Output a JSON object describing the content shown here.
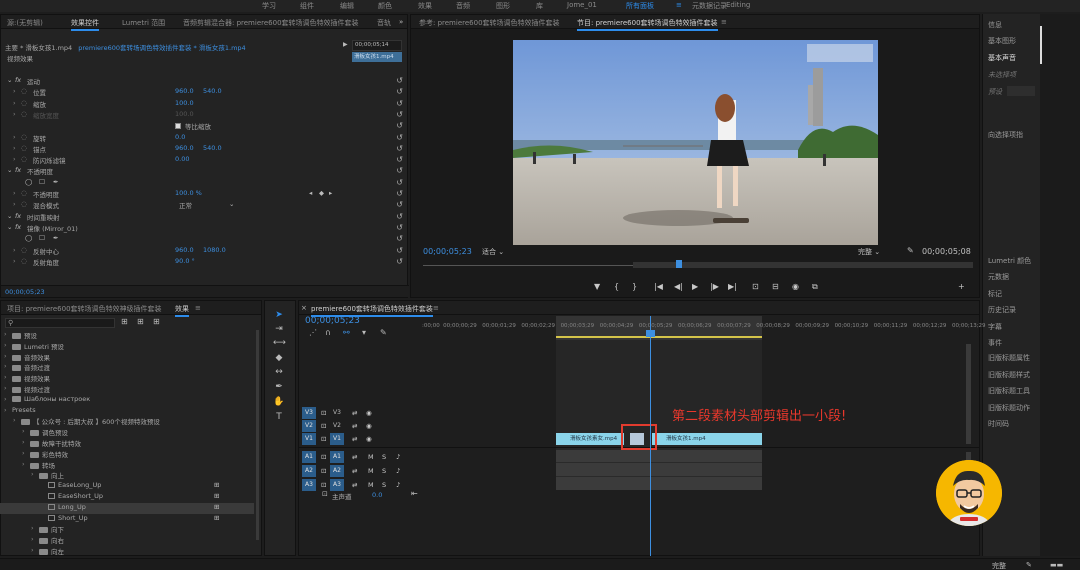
{
  "workspace": {
    "items": [
      "学习",
      "组件",
      "编辑",
      "颜色",
      "效果",
      "音频",
      "图形",
      "库",
      "Jome_01",
      "所有面板",
      "元数据记录",
      "Editing"
    ],
    "active_index": 9,
    "menu_icon": "hamburger-icon"
  },
  "effects_panel": {
    "tabs": [
      "源:(无剪辑)",
      "效果控件",
      "Lumetri 范围",
      "音频剪辑混合器: premiere600套转场调色特效插件套装",
      "音轨"
    ],
    "breadcrumb_master": "主要 * 滑板女孩1.mp4",
    "breadcrumb_seq": "premiere600套转场调色特效插件套装 * 滑板女孩1.mp4",
    "mini_timecode": "00;00;05;14",
    "mini_clip": "滑板女孩1.mp4",
    "section": "视频效果",
    "rows": [
      {
        "indent": 1,
        "fx": true,
        "label": "运动",
        "v1": "",
        "v2": ""
      },
      {
        "indent": 2,
        "label": "位置",
        "v1": "960.0",
        "v2": "540.0"
      },
      {
        "indent": 2,
        "label": "缩放",
        "v1": "100.0",
        "v2": ""
      },
      {
        "indent": 2,
        "label": "缩放宽度",
        "v1": "100.0",
        "v2": "",
        "muted": true
      },
      {
        "indent": 2,
        "label": "",
        "v1": "",
        "v2": "",
        "checkbox": "等比缩放"
      },
      {
        "indent": 2,
        "label": "旋转",
        "v1": "0.0",
        "v2": ""
      },
      {
        "indent": 2,
        "label": "锚点",
        "v1": "960.0",
        "v2": "540.0"
      },
      {
        "indent": 2,
        "label": "防闪烁滤镜",
        "v1": "0.00",
        "v2": ""
      },
      {
        "indent": 1,
        "fx": true,
        "label": "不透明度",
        "v1": "",
        "v2": ""
      },
      {
        "indent": 2,
        "label": "",
        "v1": "",
        "v2": "",
        "shapes": true
      },
      {
        "indent": 2,
        "label": "不透明度",
        "v1": "100.0 %",
        "v2": "",
        "keyframes": true
      },
      {
        "indent": 2,
        "label": "混合模式",
        "v1": "正常",
        "v2": "",
        "select": true
      },
      {
        "indent": 1,
        "fx": true,
        "label": "时间重映射",
        "v1": "",
        "v2": ""
      },
      {
        "indent": 1,
        "fx": true,
        "label": "镜像 (Mirror_01)",
        "v1": "",
        "v2": ""
      },
      {
        "indent": 2,
        "label": "",
        "v1": "",
        "v2": "",
        "shapes": true
      },
      {
        "indent": 2,
        "label": "反射中心",
        "v1": "960.0",
        "v2": "1080.0"
      },
      {
        "indent": 2,
        "label": "反射角度",
        "v1": "90.0 °",
        "v2": ""
      }
    ],
    "bottom_timecode": "00;00;05;23"
  },
  "reference_monitor": {
    "tab": "参考: premiere600套转场调色特效插件套装"
  },
  "program_monitor": {
    "tab": "节目: premiere600套转场调色特效插件套装",
    "timecode": "00;00;05;23",
    "fit": "适合",
    "quality": "完整",
    "duration": "00;00;05;08",
    "playhead_fraction": 0.46
  },
  "project_panel": {
    "tabs": [
      "项目: premiere600套转场调色特效神级插件套装",
      "效果"
    ],
    "search_placeholder": "",
    "tree": [
      {
        "indent": 0,
        "label": "预设"
      },
      {
        "indent": 0,
        "label": "Lumetri 预设"
      },
      {
        "indent": 0,
        "label": "音频效果"
      },
      {
        "indent": 0,
        "label": "音频过渡"
      },
      {
        "indent": 0,
        "label": "视频效果"
      },
      {
        "indent": 0,
        "label": "视频过渡"
      },
      {
        "indent": 0,
        "label": "Шаблоны настроек"
      },
      {
        "indent": 0,
        "label": "Presets",
        "nofolder": true
      },
      {
        "indent": 1,
        "label": "【 公众号 : 后期大叔 】600个视频特效预设"
      },
      {
        "indent": 2,
        "label": "调色预设"
      },
      {
        "indent": 2,
        "label": "故障干扰特效"
      },
      {
        "indent": 2,
        "label": "彩色特效"
      },
      {
        "indent": 2,
        "label": "转场"
      },
      {
        "indent": 3,
        "label": "向上"
      },
      {
        "indent": 4,
        "label": "EaseLong_Up",
        "preset": true
      },
      {
        "indent": 4,
        "label": "EaseShort_Up",
        "preset": true
      },
      {
        "indent": 4,
        "label": "Long_Up",
        "preset": true,
        "selected": true
      },
      {
        "indent": 4,
        "label": "Short_Up",
        "preset": true
      },
      {
        "indent": 3,
        "label": "向下"
      },
      {
        "indent": 3,
        "label": "向右"
      },
      {
        "indent": 3,
        "label": "向左"
      }
    ]
  },
  "timeline": {
    "tab": "premiere600套转场调色特效插件套装",
    "timecode": "00;00;05;23",
    "ruler": [
      ":00;00",
      "00;00;00;29",
      "00;00;01;29",
      "00;00;02;29",
      "00;00;03;29",
      "00;00;04;29",
      "00;00;05;29",
      "00;00;06;29",
      "00;00;07;29",
      "00;00;08;29",
      "00;00;09;29",
      "00;00;10;29",
      "00;00;11;29",
      "00;00;12;29",
      "00;00;13;29"
    ],
    "video_tracks": [
      "V3",
      "V2",
      "V1"
    ],
    "audio_tracks": [
      "A1",
      "A2",
      "A3"
    ],
    "master_label": "主声道",
    "master_value": "0.0",
    "clip1": "滑板女孩素女.mp4",
    "clip2": "滑板女孩1.mp4",
    "annotation": "第二段素材头部剪辑出一小段!"
  },
  "right_panel": {
    "items": [
      "信息",
      "基本图形",
      "基本声音",
      "未选择项",
      "预设",
      "向选择项指",
      "Lumetri 颜色",
      "元数据",
      "标记",
      "历史记录",
      "字幕",
      "事件",
      "旧版标题属性",
      "旧版标题样式",
      "旧版标题工具",
      "旧版标题动作",
      "时间码"
    ]
  },
  "status": {
    "quality": "完整"
  }
}
